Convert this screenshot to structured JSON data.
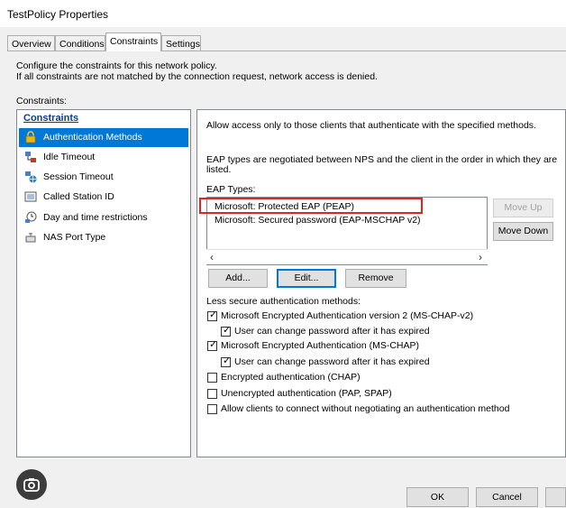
{
  "window": {
    "title": "TestPolicy Properties"
  },
  "tabs": [
    {
      "label": "Overview"
    },
    {
      "label": "Conditions"
    },
    {
      "label": "Constraints"
    },
    {
      "label": "Settings"
    }
  ],
  "intro": {
    "line1": "Configure the constraints for this network policy.",
    "line2": "If all constraints are not matched by the connection request, network access is denied."
  },
  "constraints_label": "Constraints:",
  "left_panel": {
    "header": "Constraints",
    "items": [
      {
        "label": "Authentication Methods",
        "icon": "lock-icon"
      },
      {
        "label": "Idle Timeout",
        "icon": "network-icon"
      },
      {
        "label": "Session Timeout",
        "icon": "network-globe-icon"
      },
      {
        "label": "Called Station ID",
        "icon": "phone-list-icon"
      },
      {
        "label": "Day and time restrictions",
        "icon": "clock-network-icon"
      },
      {
        "label": "NAS Port Type",
        "icon": "port-icon"
      }
    ]
  },
  "right_panel": {
    "description": "Allow access only to those clients that authenticate with the specified methods.",
    "eap_note_line1": "EAP types are negotiated between NPS and the client in the order in which they are",
    "eap_note_line2": "listed.",
    "eap_types_label": "EAP Types:",
    "eap_types": [
      "Microsoft: Protected EAP (PEAP)",
      "Microsoft: Secured password (EAP-MSCHAP v2)"
    ],
    "buttons": {
      "move_up": "Move Up",
      "move_down": "Move Down",
      "add": "Add...",
      "edit": "Edit...",
      "remove": "Remove"
    },
    "less_secure_label": "Less secure authentication methods:",
    "checkboxes": [
      {
        "label": "Microsoft Encrypted Authentication version 2 (MS-CHAP-v2)",
        "checked": true
      },
      {
        "label": "User can change password after it has expired",
        "checked": true
      },
      {
        "label": "Microsoft Encrypted Authentication (MS-CHAP)",
        "checked": true
      },
      {
        "label": "User can change password after it has expired",
        "checked": true
      },
      {
        "label": "Encrypted authentication (CHAP)",
        "checked": false
      },
      {
        "label": "Unencrypted authentication (PAP, SPAP)",
        "checked": false
      },
      {
        "label": "Allow clients to connect without negotiating an authentication method",
        "checked": false
      }
    ]
  },
  "footer": {
    "ok": "OK",
    "cancel": "Cancel"
  },
  "colors": {
    "selection": "#0078d7",
    "highlight_box": "#e02424",
    "header_link": "#0b3e8a"
  }
}
